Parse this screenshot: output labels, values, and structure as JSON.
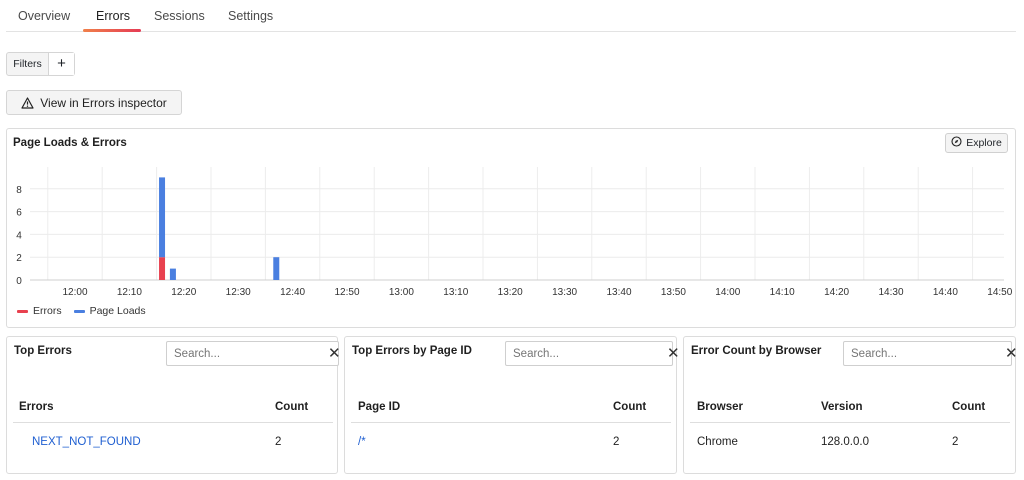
{
  "tabs": [
    {
      "label": "Overview",
      "active": false
    },
    {
      "label": "Errors",
      "active": true
    },
    {
      "label": "Sessions",
      "active": false
    },
    {
      "label": "Settings",
      "active": false
    }
  ],
  "filters": {
    "label": "Filters",
    "add_label": "+"
  },
  "inspector_button": {
    "label": "View in Errors inspector",
    "icon": "warning-triangle-icon"
  },
  "chart_panel": {
    "title": "Page Loads & Errors",
    "explore_label": "Explore",
    "explore_icon": "compass-icon"
  },
  "chart_data": {
    "type": "bar",
    "title": "Page Loads & Errors",
    "x_ticks": [
      "12:00",
      "12:10",
      "12:20",
      "12:30",
      "12:40",
      "12:50",
      "13:00",
      "13:10",
      "13:20",
      "13:30",
      "13:40",
      "13:50",
      "14:00",
      "14:10",
      "14:20",
      "14:30",
      "14:40",
      "14:50"
    ],
    "y_ticks": [
      0,
      2,
      4,
      6,
      8
    ],
    "ylim": [
      0,
      10
    ],
    "stacked": true,
    "grid": true,
    "legend_position": "bottom-left",
    "series": [
      {
        "name": "Errors",
        "color": "#e8414f",
        "points": [
          {
            "x": "12:16",
            "y": 2
          },
          {
            "x": "12:18",
            "y": 0
          },
          {
            "x": "12:37",
            "y": 0
          }
        ]
      },
      {
        "name": "Page Loads",
        "color": "#4a7fe0",
        "points": [
          {
            "x": "12:16",
            "y": 7
          },
          {
            "x": "12:18",
            "y": 1
          },
          {
            "x": "12:37",
            "y": 2
          }
        ]
      }
    ]
  },
  "top_errors": {
    "title": "Top Errors",
    "search_placeholder": "Search...",
    "columns": [
      "Errors",
      "Count"
    ],
    "rows": [
      {
        "error": "NEXT_NOT_FOUND",
        "count": "2"
      }
    ]
  },
  "top_errors_by_page": {
    "title": "Top Errors by Page ID",
    "search_placeholder": "Search...",
    "columns": [
      "Page ID",
      "Count"
    ],
    "rows": [
      {
        "page_id": "/*",
        "count": "2"
      }
    ]
  },
  "errors_by_browser": {
    "title": "Error Count by Browser",
    "search_placeholder": "Search...",
    "columns": [
      "Browser",
      "Version",
      "Count"
    ],
    "rows": [
      {
        "browser": "Chrome",
        "version": "128.0.0.0",
        "count": "2"
      }
    ]
  }
}
